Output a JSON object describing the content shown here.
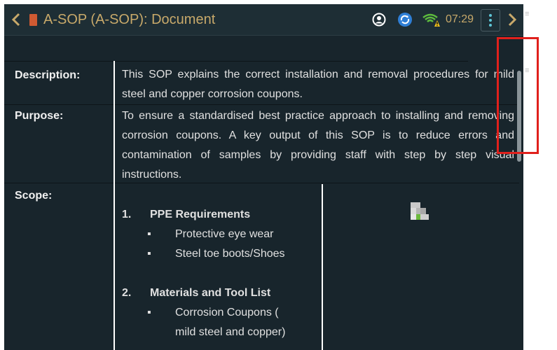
{
  "window": {
    "title": "A-SOP (A-SOP): Document",
    "time": "07:29"
  },
  "icons": {
    "back": "chevron-left-icon",
    "forward": "chevron-right-icon",
    "document": "document-icon",
    "user": "user-icon",
    "sync": "sync-icon",
    "wifi": "wifi-warning-icon",
    "menu": "kebab-menu-icon"
  },
  "document": {
    "description": {
      "label": "Description:",
      "text": "This SOP explains the correct installation and removal procedures for mild steel and copper corrosion coupons."
    },
    "purpose": {
      "label": "Purpose:",
      "text": "To ensure a standardised best practice approach to installing and removing corrosion coupons. A key output of this SOP is to reduce errors and contamination of samples by providing staff with step by step visual instructions."
    },
    "scope": {
      "label": "Scope:",
      "sections": [
        {
          "number": "1.",
          "heading": "PPE Requirements",
          "items": [
            "Protective eye wear",
            "Steel toe boots/Shoes"
          ]
        },
        {
          "number": "2.",
          "heading": "Materials and Tool List",
          "items": [
            "Corrosion Coupons (",
            "mild steel and copper)"
          ]
        }
      ]
    }
  },
  "colors": {
    "window_bg": "#18252c",
    "titlebar_bg": "#1e2e35",
    "accent": "#c8a96a",
    "highlight": "#e0201c",
    "menu_dots": "#5ec6d6"
  }
}
